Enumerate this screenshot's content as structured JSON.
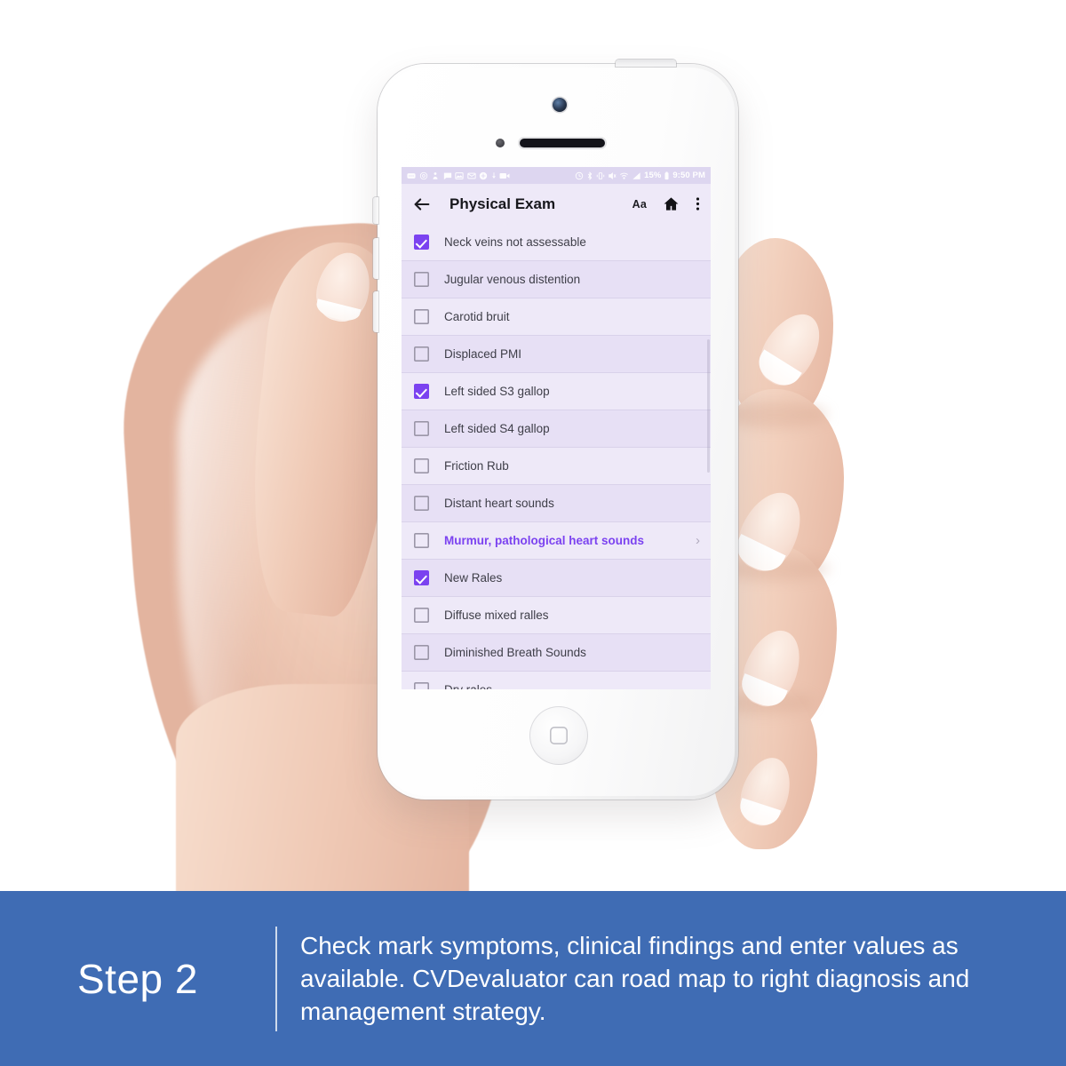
{
  "statusbar": {
    "left_icons": [
      "messages-icon",
      "camera-icon",
      "contact-icon",
      "chat-icon",
      "photo-icon",
      "email-icon",
      "add-circle-icon",
      "download-icon",
      "video-icon"
    ],
    "right_icons": [
      "alarm-icon",
      "bluetooth-icon",
      "vibrate-icon",
      "mute-icon",
      "wifi-icon",
      "signal-icon"
    ],
    "battery_percent": "15%",
    "battery_icon": "battery-icon",
    "time": "9:50 PM"
  },
  "appbar": {
    "back_icon": "back-arrow-icon",
    "title": "Physical Exam",
    "font_size_label": "Aa",
    "home_icon": "home-icon",
    "overflow_icon": "overflow-menu-icon"
  },
  "list": {
    "chevron": "›",
    "items": [
      {
        "label": "Neck veins not assessable",
        "checked": true,
        "link": false
      },
      {
        "label": "Jugular venous distention",
        "checked": false,
        "link": false
      },
      {
        "label": "Carotid bruit",
        "checked": false,
        "link": false
      },
      {
        "label": "Displaced PMI",
        "checked": false,
        "link": false
      },
      {
        "label": "Left sided S3 gallop",
        "checked": true,
        "link": false
      },
      {
        "label": "Left sided S4 gallop",
        "checked": false,
        "link": false
      },
      {
        "label": "Friction Rub",
        "checked": false,
        "link": false
      },
      {
        "label": "Distant heart sounds",
        "checked": false,
        "link": false
      },
      {
        "label": "Murmur, pathological heart sounds",
        "checked": false,
        "link": true
      },
      {
        "label": "New Rales",
        "checked": true,
        "link": false
      },
      {
        "label": "Diffuse mixed ralles",
        "checked": false,
        "link": false
      },
      {
        "label": "Diminished Breath Sounds",
        "checked": false,
        "link": false
      },
      {
        "label": "Dry rales",
        "checked": false,
        "link": false
      }
    ]
  },
  "banner": {
    "step": "Step 2",
    "text": "Check mark symptoms, clinical findings and enter values as available. CVDevaluator can road map to right diagnosis and management strategy."
  },
  "colors": {
    "accent_purple": "#7b42f0",
    "screen_bg": "#eee9f8",
    "row_alt": "#e7e0f5",
    "banner_blue": "#3f6cb4"
  }
}
